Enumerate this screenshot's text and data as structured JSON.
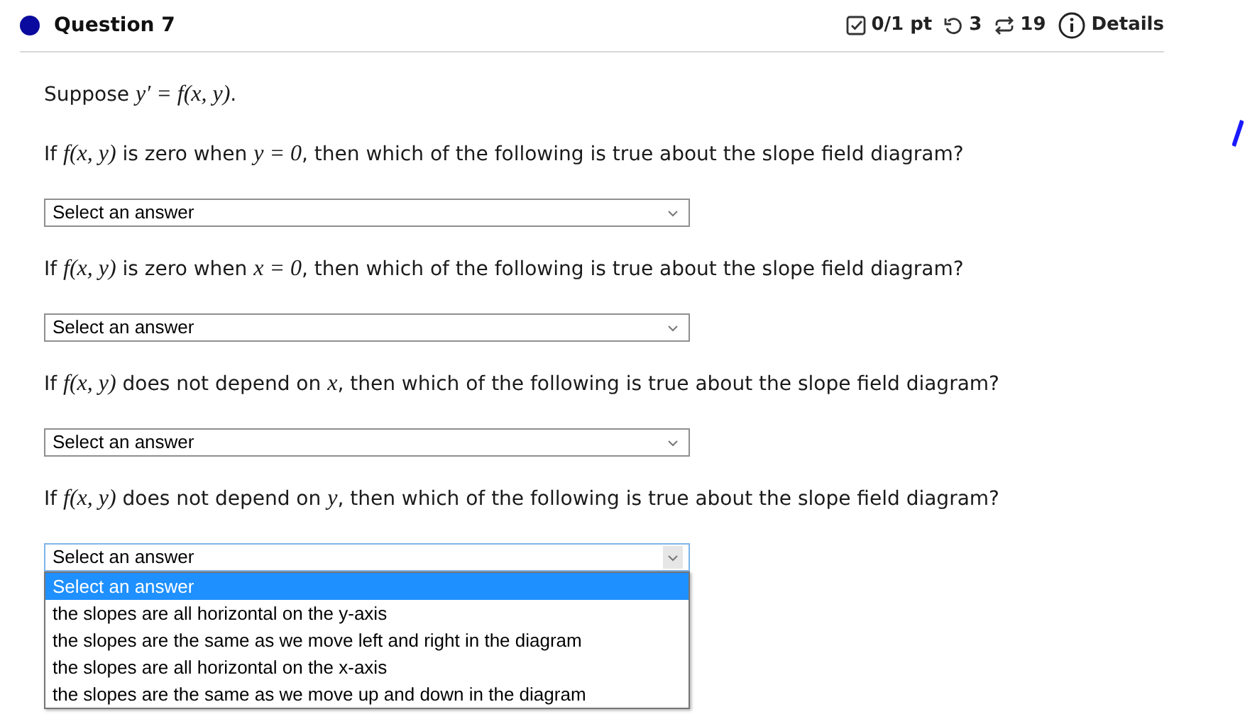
{
  "header": {
    "title": "Question 7",
    "score": "0/1 pt",
    "retries": "3",
    "attempts": "19",
    "details": "Details"
  },
  "intro": [
    {
      "kind": "text",
      "text": "Suppose "
    },
    {
      "kind": "math",
      "text": "y′ = f(x, y)"
    },
    {
      "kind": "text",
      "text": "."
    }
  ],
  "questions": [
    {
      "prompt": [
        {
          "kind": "text",
          "text": "If "
        },
        {
          "kind": "math",
          "text": "f(x, y)"
        },
        {
          "kind": "text",
          "text": " is zero when "
        },
        {
          "kind": "math",
          "text": "y = 0"
        },
        {
          "kind": "text",
          "text": ", then which of the following is true about the slope field diagram?"
        }
      ],
      "select": {
        "value": "Select an answer",
        "expanded": false
      }
    },
    {
      "prompt": [
        {
          "kind": "text",
          "text": "If "
        },
        {
          "kind": "math",
          "text": "f(x, y)"
        },
        {
          "kind": "text",
          "text": " is zero when "
        },
        {
          "kind": "math",
          "text": "x = 0"
        },
        {
          "kind": "text",
          "text": ", then which of the following is true about the slope field diagram?"
        }
      ],
      "select": {
        "value": "Select an answer",
        "expanded": false
      }
    },
    {
      "prompt": [
        {
          "kind": "text",
          "text": "If "
        },
        {
          "kind": "math",
          "text": "f(x, y)"
        },
        {
          "kind": "text",
          "text": " does not depend on "
        },
        {
          "kind": "math",
          "text": "x"
        },
        {
          "kind": "text",
          "text": ", then which of the following is true about the slope field diagram?"
        }
      ],
      "select": {
        "value": "Select an answer",
        "expanded": false
      }
    },
    {
      "prompt": [
        {
          "kind": "text",
          "text": "If "
        },
        {
          "kind": "math",
          "text": "f(x, y)"
        },
        {
          "kind": "text",
          "text": " does not depend on "
        },
        {
          "kind": "math",
          "text": "y"
        },
        {
          "kind": "text",
          "text": ", then which of the following is true about the slope field diagram?"
        }
      ],
      "select": {
        "value": "Select an answer",
        "expanded": true,
        "options": [
          {
            "label": "Select an answer",
            "selected": true
          },
          {
            "label": "the slopes are all horizontal on the y-axis",
            "selected": false
          },
          {
            "label": "the slopes are the same as we move left and right in the diagram",
            "selected": false
          },
          {
            "label": "the slopes are all horizontal on the x-axis",
            "selected": false
          },
          {
            "label": "the slopes are the same as we move up and down in the diagram",
            "selected": false
          }
        ]
      }
    }
  ]
}
